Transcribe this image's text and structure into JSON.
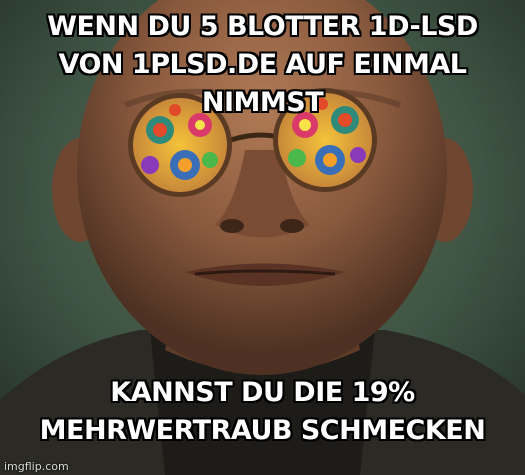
{
  "meme": {
    "top_text": [
      "WENN DU 5 BLOTTER 1D-LSD",
      "VON 1PLSD.DE AUF EINMAL NIMMST"
    ],
    "bottom_text": [
      "KANNST DU DIE 19%",
      "MEHRWERTRAUB SCHMECKEN"
    ],
    "watermark": "imgflip.com"
  },
  "colors": {
    "background": "#3f5444",
    "skin": "#8a5a3e",
    "lens_rim": "#5a3a22"
  }
}
